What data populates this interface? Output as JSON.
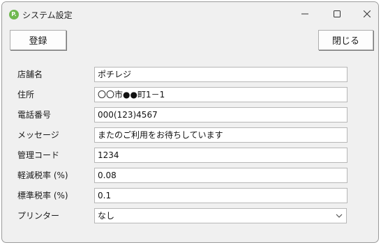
{
  "window": {
    "title": "システム設定",
    "icon_text": "P.",
    "icons": {
      "app": "register-app-icon",
      "minimize": "minimize-icon",
      "maximize": "maximize-icon",
      "close": "close-icon"
    }
  },
  "toolbar": {
    "register_label": "登録",
    "close_label": "閉じる"
  },
  "form": {
    "store_name": {
      "label": "店舗名",
      "value": "ポチレジ"
    },
    "address": {
      "label": "住所",
      "value": "〇〇市●●町1－1"
    },
    "phone": {
      "label": "電話番号",
      "value": "000(123)4567"
    },
    "message": {
      "label": "メッセージ",
      "value": "またのご利用をお待ちしています"
    },
    "admin_code": {
      "label": "管理コード",
      "value": "1234"
    },
    "reduced_tax": {
      "label": "軽減税率 (%)",
      "value": "0.08"
    },
    "standard_tax": {
      "label": "標準税率 (%)",
      "value": "0.1"
    },
    "printer": {
      "label": "プリンター",
      "value": "なし",
      "icon": "chevron-down-icon"
    }
  },
  "colors": {
    "window_bg": "#f0f0f0",
    "field_bg": "#ffffff",
    "app_icon": "#6fb84f"
  }
}
